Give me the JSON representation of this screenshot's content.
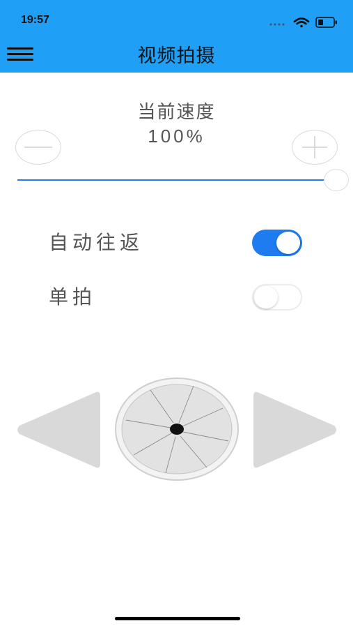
{
  "status_bar": {
    "time": "19:57",
    "icons": [
      "signal-dots-icon",
      "wifi-icon",
      "battery-icon"
    ]
  },
  "header": {
    "title": "视频拍摄",
    "menu_icon": "hamburger-menu-icon",
    "background_color": "#1fa0f6"
  },
  "speed": {
    "label": "当前速度",
    "value": "100%",
    "decrease_icon": "minus-icon",
    "increase_icon": "plus-icon",
    "slider_level": 1.0
  },
  "settings": [
    {
      "label": "自动往返",
      "enabled": true
    },
    {
      "label": "单拍",
      "enabled": false
    }
  ],
  "controls": {
    "left_icon": "triangle-left-icon",
    "center_icon": "shutter-aperture-icon",
    "right_icon": "triangle-right-icon"
  },
  "colors": {
    "accent": "#1e7cf0",
    "text": "#555555"
  }
}
